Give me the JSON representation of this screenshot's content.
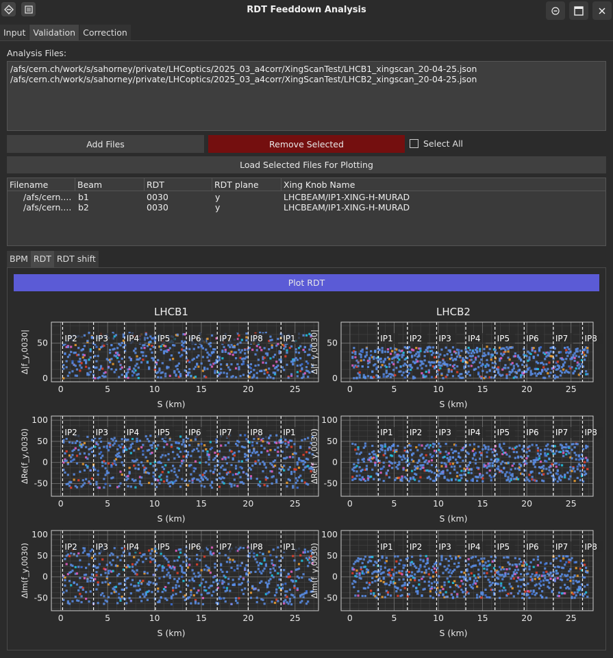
{
  "window": {
    "title": "RDT Feeddown Analysis"
  },
  "main_tabs": [
    "Input",
    "Validation",
    "Correction"
  ],
  "analysis": {
    "label": "Analysis Files:",
    "files": [
      "/afs/cern.ch/work/s/sahorney/private/LHCoptics/2025_03_a4corr/XingScanTest/LHCB1_xingscan_20-04-25.json",
      "/afs/cern.ch/work/s/sahorney/private/LHCoptics/2025_03_a4corr/XingScanTest/LHCB2_xingscan_20-04-25.json"
    ]
  },
  "buttons": {
    "add_files": "Add Files",
    "remove_selected": "Remove Selected",
    "select_all": "Select All",
    "load_selected": "Load Selected Files For Plotting",
    "plot_rdt": "Plot RDT"
  },
  "table": {
    "columns": [
      "Filename",
      "Beam",
      "RDT",
      "RDT plane",
      "Xing Knob Name"
    ],
    "rows": [
      [
        "/afs/cern....",
        "b1",
        "0030",
        "y",
        "LHCBEAM/IP1-XING-H-MURAD"
      ],
      [
        "/afs/cern....",
        "b2",
        "0030",
        "y",
        "LHCBEAM/IP1-XING-H-MURAD"
      ]
    ]
  },
  "sub_tabs": [
    "BPM",
    "RDT",
    "RDT shift"
  ],
  "colors": {
    "accent": "#5b5bd6",
    "danger": "#740f0f",
    "marker": "#6aa0e8"
  },
  "chart_data": [
    {
      "type": "scatter",
      "title": "LHCB1",
      "xlabel": "S (km)",
      "ylabel": "Δ|f_y,0030|",
      "xlim": [
        -1,
        27.5
      ],
      "ylim": [
        -5,
        80
      ],
      "xticks": [
        0,
        5,
        10,
        15,
        20,
        25
      ],
      "yticks": [
        0,
        50
      ],
      "grid": true,
      "ip_labels": [
        {
          "label": "IP2",
          "s": 0.2
        },
        {
          "label": "IP3",
          "s": 3.5
        },
        {
          "label": "IP4",
          "s": 6.8
        },
        {
          "label": "IP5",
          "s": 10.1
        },
        {
          "label": "IP6",
          "s": 13.4
        },
        {
          "label": "IP7",
          "s": 16.7
        },
        {
          "label": "IP8",
          "s": 20.0
        },
        {
          "label": "IP1",
          "s": 23.5
        }
      ],
      "series": [
        {
          "values_band": [
            0,
            65
          ]
        }
      ]
    },
    {
      "type": "scatter",
      "title": "LHCB2",
      "xlabel": "S (km)",
      "ylabel": "Δ|f_y,0030|",
      "xlim": [
        -1,
        27.5
      ],
      "ylim": [
        -5,
        80
      ],
      "xticks": [
        0,
        5,
        10,
        15,
        20,
        25
      ],
      "yticks": [
        0,
        50
      ],
      "grid": true,
      "ip_labels": [
        {
          "label": "IP1",
          "s": 3.2
        },
        {
          "label": "IP2",
          "s": 6.5
        },
        {
          "label": "IP3",
          "s": 9.8
        },
        {
          "label": "IP4",
          "s": 13.1
        },
        {
          "label": "IP5",
          "s": 16.4
        },
        {
          "label": "IP6",
          "s": 19.7
        },
        {
          "label": "IP7",
          "s": 23.0
        },
        {
          "label": "IP8",
          "s": 26.3
        }
      ],
      "series": [
        {
          "values_band": [
            0,
            45
          ]
        }
      ]
    },
    {
      "type": "scatter",
      "title": "",
      "xlabel": "S (km)",
      "ylabel": "ΔRe(f_y,0030)",
      "xlim": [
        -1,
        27.5
      ],
      "ylim": [
        -80,
        110
      ],
      "xticks": [
        0,
        5,
        10,
        15,
        20,
        25
      ],
      "yticks": [
        -50,
        0,
        50,
        100
      ],
      "grid": true,
      "ip_labels": [
        {
          "label": "IP2",
          "s": 0.2
        },
        {
          "label": "IP3",
          "s": 3.5
        },
        {
          "label": "IP4",
          "s": 6.8
        },
        {
          "label": "IP5",
          "s": 10.1
        },
        {
          "label": "IP6",
          "s": 13.4
        },
        {
          "label": "IP7",
          "s": 16.7
        },
        {
          "label": "IP8",
          "s": 20.0
        },
        {
          "label": "IP1",
          "s": 23.5
        }
      ],
      "series": [
        {
          "values_band": [
            -60,
            65
          ]
        }
      ]
    },
    {
      "type": "scatter",
      "title": "",
      "xlabel": "S (km)",
      "ylabel": "ΔRe(f_y,0030)",
      "xlim": [
        -1,
        27.5
      ],
      "ylim": [
        -80,
        110
      ],
      "xticks": [
        0,
        5,
        10,
        15,
        20,
        25
      ],
      "yticks": [
        -50,
        0,
        50,
        100
      ],
      "grid": true,
      "ip_labels": [
        {
          "label": "IP1",
          "s": 3.2
        },
        {
          "label": "IP2",
          "s": 6.5
        },
        {
          "label": "IP3",
          "s": 9.8
        },
        {
          "label": "IP4",
          "s": 13.1
        },
        {
          "label": "IP5",
          "s": 16.4
        },
        {
          "label": "IP6",
          "s": 19.7
        },
        {
          "label": "IP7",
          "s": 23.0
        },
        {
          "label": "IP8",
          "s": 26.3
        }
      ],
      "series": [
        {
          "values_band": [
            -45,
            45
          ]
        }
      ]
    },
    {
      "type": "scatter",
      "title": "",
      "xlabel": "S (km)",
      "ylabel": "ΔIm(f_y,0030)",
      "xlim": [
        -1,
        27.5
      ],
      "ylim": [
        -80,
        110
      ],
      "xticks": [
        0,
        5,
        10,
        15,
        20,
        25
      ],
      "yticks": [
        -50,
        0,
        50,
        100
      ],
      "grid": true,
      "ip_labels": [
        {
          "label": "IP2",
          "s": 0.2
        },
        {
          "label": "IP3",
          "s": 3.5
        },
        {
          "label": "IP4",
          "s": 6.8
        },
        {
          "label": "IP5",
          "s": 10.1
        },
        {
          "label": "IP6",
          "s": 13.4
        },
        {
          "label": "IP7",
          "s": 16.7
        },
        {
          "label": "IP8",
          "s": 20.0
        },
        {
          "label": "IP1",
          "s": 23.5
        }
      ],
      "series": [
        {
          "values_band": [
            -65,
            70
          ]
        }
      ]
    },
    {
      "type": "scatter",
      "title": "",
      "xlabel": "S (km)",
      "ylabel": "ΔIm(f_y,0030)",
      "xlim": [
        -1,
        27.5
      ],
      "ylim": [
        -80,
        110
      ],
      "xticks": [
        0,
        5,
        10,
        15,
        20,
        25
      ],
      "yticks": [
        -50,
        0,
        50,
        100
      ],
      "grid": true,
      "ip_labels": [
        {
          "label": "IP1",
          "s": 3.2
        },
        {
          "label": "IP2",
          "s": 6.5
        },
        {
          "label": "IP3",
          "s": 9.8
        },
        {
          "label": "IP4",
          "s": 13.1
        },
        {
          "label": "IP5",
          "s": 16.4
        },
        {
          "label": "IP6",
          "s": 19.7
        },
        {
          "label": "IP7",
          "s": 23.0
        },
        {
          "label": "IP8",
          "s": 26.3
        }
      ],
      "series": [
        {
          "values_band": [
            -50,
            50
          ]
        }
      ]
    }
  ]
}
